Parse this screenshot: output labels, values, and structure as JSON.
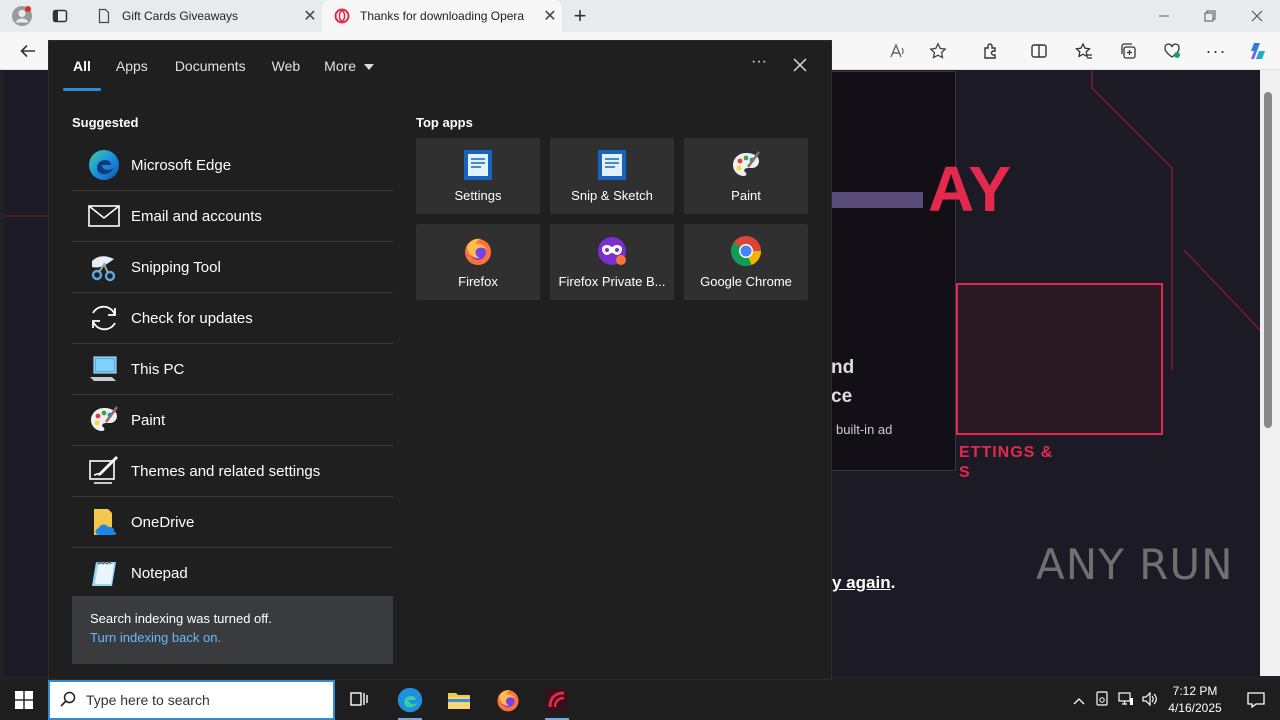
{
  "browser": {
    "tabs": [
      {
        "label": "Gift Cards Giveaways",
        "icon": "page-icon"
      },
      {
        "label": "Thanks for downloading Opera",
        "icon": "opera-icon"
      }
    ],
    "new_tab_label": "+",
    "close_glyph": "✕"
  },
  "page_behind": {
    "headline_fragment": "AY",
    "line1": "nd",
    "line2": "ce",
    "body_fragment": "built-in ad",
    "button_fragment_1": "ETTINGS &",
    "button_fragment_2": "S",
    "link_fragment": "y again",
    "link_suffix": ".",
    "watermark": "ANY RUN"
  },
  "search_flyout": {
    "tabs": [
      {
        "label": "All",
        "active": true
      },
      {
        "label": "Apps",
        "active": false
      },
      {
        "label": "Documents",
        "active": false
      },
      {
        "label": "Web",
        "active": false
      },
      {
        "label": "More",
        "active": false
      }
    ],
    "more_options_glyph": "···",
    "suggested_title": "Suggested",
    "suggested": [
      {
        "label": "Microsoft Edge",
        "icon": "edge-icon"
      },
      {
        "label": "Email and accounts",
        "icon": "mail-icon"
      },
      {
        "label": "Snipping Tool",
        "icon": "scissors-icon"
      },
      {
        "label": "Check for updates",
        "icon": "refresh-icon"
      },
      {
        "label": "This PC",
        "icon": "computer-icon"
      },
      {
        "label": "Paint",
        "icon": "paint-palette-icon"
      },
      {
        "label": "Themes and related settings",
        "icon": "themes-icon"
      },
      {
        "label": "OneDrive",
        "icon": "onedrive-icon"
      },
      {
        "label": "Notepad",
        "icon": "notepad-icon"
      }
    ],
    "notice": {
      "text": "Search indexing was turned off.",
      "link": "Turn indexing back on."
    },
    "top_apps_title": "Top apps",
    "top_apps": [
      {
        "label": "Settings",
        "icon": "settings-doc-icon"
      },
      {
        "label": "Snip & Sketch",
        "icon": "snip-sketch-icon"
      },
      {
        "label": "Paint",
        "icon": "paint-palette-icon"
      },
      {
        "label": "Firefox",
        "icon": "firefox-icon"
      },
      {
        "label": "Firefox Private B...",
        "icon": "firefox-private-icon"
      },
      {
        "label": "Google Chrome",
        "icon": "chrome-icon"
      }
    ]
  },
  "taskbar": {
    "search_placeholder": "Type here to search",
    "clock_time": "7:12 PM",
    "clock_date": "4/16/2025",
    "pinned": [
      "task-view-icon",
      "edge-icon",
      "file-explorer-icon",
      "firefox-icon",
      "opera-icon"
    ]
  },
  "colors": {
    "accent": "#2e8bd6",
    "flyout_bg": "#1f1f1f",
    "tile_bg": "#303030",
    "neon_red": "#e32a4e"
  }
}
